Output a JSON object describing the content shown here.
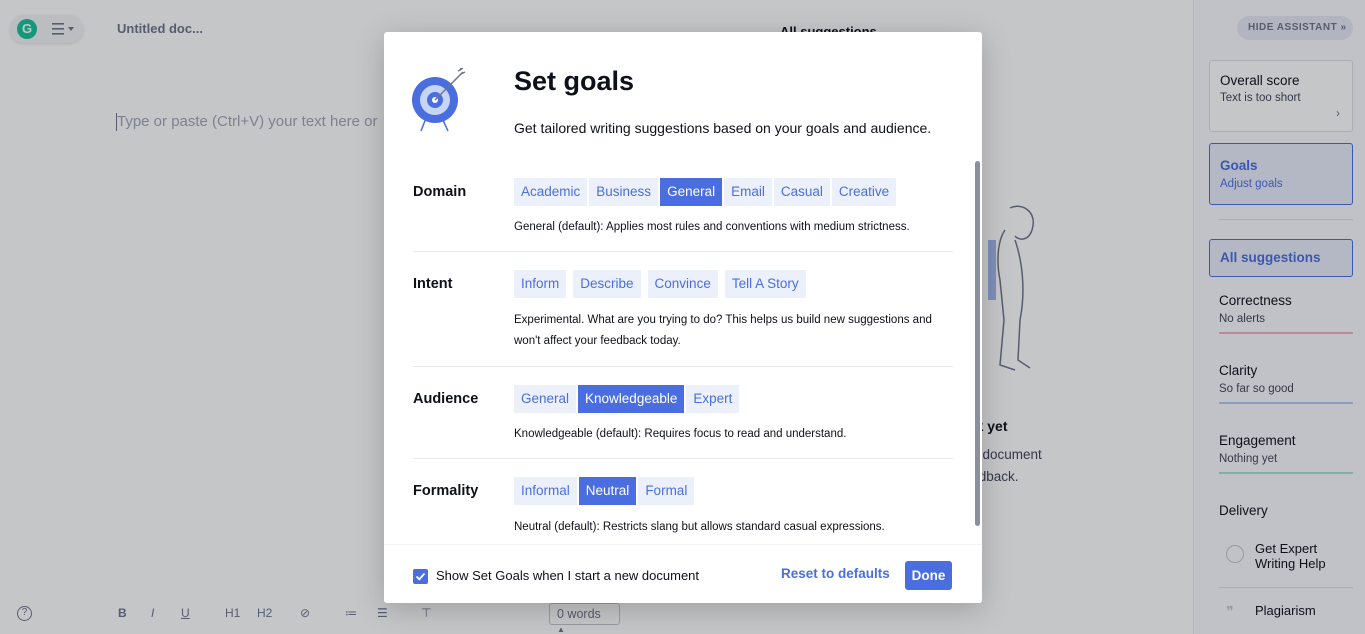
{
  "editor": {
    "document_title": "Untitled doc...",
    "placeholder": "Type or paste (Ctrl+V) your text here or",
    "word_count": "0 words"
  },
  "toolbar": {
    "help": "?",
    "bold": "B",
    "italic": "I",
    "underline": "U",
    "h1": "H1",
    "h2": "H2",
    "link": "⊘",
    "ordered_list": "≔",
    "bullet_list": "☰",
    "clear_format": "⊤"
  },
  "background_panel": {
    "title": "All suggestions",
    "empty_title": "eck yet",
    "empty_line1": "d a document",
    "empty_line2": "feedback."
  },
  "sidebar": {
    "hide_assistant": "HIDE ASSISTANT",
    "overall_score": {
      "title": "Overall score",
      "subtitle": "Text is too short"
    },
    "goals": {
      "title": "Goals",
      "subtitle": "Adjust goals"
    },
    "all_suggestions": "All suggestions",
    "categories": [
      {
        "title": "Correctness",
        "subtitle": "No alerts",
        "color": "#f0b3bc"
      },
      {
        "title": "Clarity",
        "subtitle": "So far so good",
        "color": "#b3c8ef"
      },
      {
        "title": "Engagement",
        "subtitle": "Nothing yet",
        "color": "#a9e0d6"
      },
      {
        "title": "Delivery",
        "subtitle": "",
        "color": ""
      }
    ],
    "expert_help": "Get Expert Writing Help",
    "plagiarism": "Plagiarism"
  },
  "modal": {
    "title": "Set goals",
    "subtitle": "Get tailored writing suggestions based on your goals and audience.",
    "domain": {
      "label": "Domain",
      "options": [
        "Academic",
        "Business",
        "General",
        "Email",
        "Casual",
        "Creative"
      ],
      "selected": "General",
      "description": "General (default): Applies most rules and conventions with medium strictness."
    },
    "intent": {
      "label": "Intent",
      "options": [
        "Inform",
        "Describe",
        "Convince",
        "Tell A Story"
      ],
      "selected": "",
      "description_line1": "Experimental. What are you trying to do? This helps us build new suggestions and",
      "description_line2": "won't affect your feedback today."
    },
    "audience": {
      "label": "Audience",
      "options": [
        "General",
        "Knowledgeable",
        "Expert"
      ],
      "selected": "Knowledgeable",
      "description": "Knowledgeable (default): Requires focus to read and understand."
    },
    "formality": {
      "label": "Formality",
      "options": [
        "Informal",
        "Neutral",
        "Formal"
      ],
      "selected": "Neutral",
      "description": "Neutral (default): Restricts slang but allows standard casual expressions."
    },
    "footer": {
      "checkbox_label": "Show Set Goals when I start a new document",
      "checkbox_checked": true,
      "reset_label": "Reset to defaults",
      "done_label": "Done"
    }
  },
  "colors": {
    "accent": "#4a6ee0",
    "grammarly_green": "#15c39a"
  }
}
